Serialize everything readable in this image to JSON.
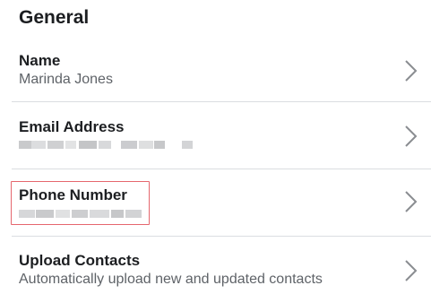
{
  "section": {
    "title": "General"
  },
  "rows": [
    {
      "label": "Name",
      "value": "Marinda Jones",
      "icon": "chevron-right-icon"
    },
    {
      "label": "Email Address",
      "value": "",
      "icon": "chevron-right-icon",
      "value_redacted": true
    },
    {
      "label": "Phone Number",
      "value": "",
      "icon": "chevron-right-icon",
      "value_redacted": true,
      "highlighted": true
    },
    {
      "label": "Upload Contacts",
      "value": "Automatically upload new and updated contacts",
      "icon": "chevron-right-icon"
    }
  ],
  "colors": {
    "text_primary": "#1c1e21",
    "text_secondary": "#5f6368",
    "divider": "#dadde1",
    "chevron": "#8a8d91",
    "highlight": "#e5676e"
  }
}
